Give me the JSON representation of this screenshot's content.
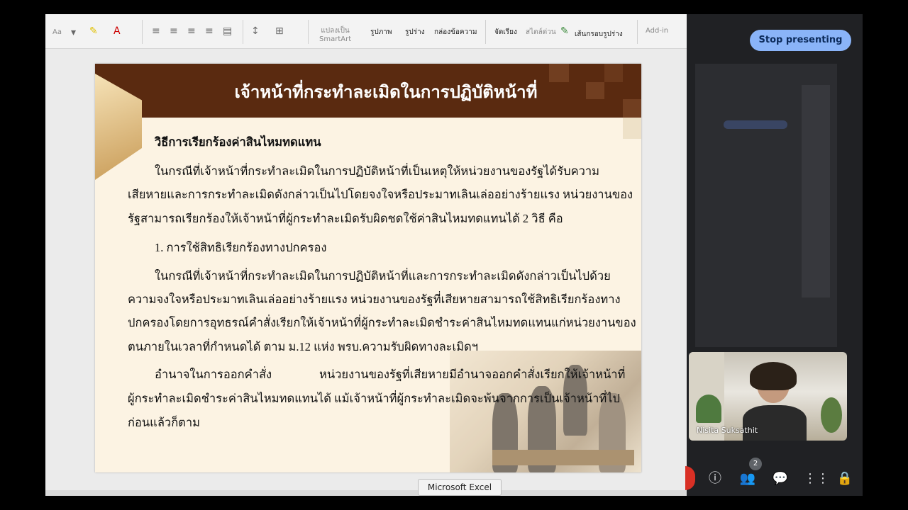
{
  "ribbon": {
    "font_size_label": "Aa",
    "smartart_label": "แปลงเป็น\nSmartArt",
    "picture_label": "รูปภาพ",
    "shape_label": "รูปร่าง",
    "textbox_label": "กล่องข้อความ",
    "arrange_label": "จัดเรียง",
    "quick_styles_label": "สไตล์ด่วน",
    "shape_outline_label": "เส้นกรอบรูปร่าง",
    "addin_label": "Add-in"
  },
  "slide": {
    "title": "เจ้าหน้าที่กระทำละเมิดในการปฏิบัติหน้าที่",
    "heading": "วิธีการเรียกร้องค่าสินไหมทดแทน",
    "lines": [
      "ในกรณีที่เจ้าหน้าที่กระทำละเมิดในการปฏิบัติหน้าที่เป็นเหตุให้หน่วยงานของรัฐได้รับความ",
      "เสียหายและการกระทำละเมิดดังกล่าวเป็นไปโดยจงใจหรือประมาทเลินเล่ออย่างร้ายแรง หน่วยงานของ",
      "รัฐสามารถเรียกร้องให้เจ้าหน้าที่ผู้กระทำละเมิดรับผิดชดใช้ค่าสินไหมทดแทนได้ 2 วิธี คือ",
      "1. การใช้สิทธิเรียกร้องทางปกครอง",
      "ในกรณีที่เจ้าหน้าที่กระทำละเมิดในการปฏิบัติหน้าที่และการกระทำละเมิดดังกล่าวเป็นไปด้วย",
      "ความจงใจหรือประมาทเลินเล่ออย่างร้ายแรง หน่วยงานของรัฐที่เสียหายสามารถใช้สิทธิเรียกร้องทาง",
      "ปกครองโดยการอุทธรณ์คำสั่งเรียกให้เจ้าหน้าที่ผู้กระทำละเมิดชำระค่าสินไหมทดแทนแก่หน่วยงานของ",
      "ตนภายในเวลาที่กำหนดได้ ตาม ม.12 แห่ง พรบ.ความรับผิดทางละเมิดฯ",
      "อำนาจในการออกคำสั่ง",
      "หน่วยงานของรัฐที่เสียหายมีอำนาจออกคำสั่งเรียกให้เจ้าหน้าที่",
      "ผู้กระทำละเมิดชำระค่าสินไหมทดแทนได้  แม้เจ้าหน้าที่ผู้กระทำละเมิดจะพ้นจากการเป็นเจ้าหน้าที่ไป",
      "ก่อนแล้วก็ตาม"
    ]
  },
  "tooltip": "Microsoft Excel",
  "meet": {
    "stop_presenting": "Stop presenting",
    "participant_name": "Nisita Suksathit",
    "people_count": "2"
  }
}
